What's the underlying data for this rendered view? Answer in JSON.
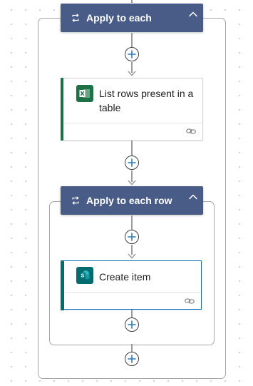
{
  "colors": {
    "scope_header": "#485c87",
    "excel": "#1e7145",
    "sharepoint": "#036c70",
    "plus": "#2a7ab8"
  },
  "outer_scope": {
    "title": "Apply to each",
    "icon": "loop-icon",
    "collapse_icon": "chevron-up-icon"
  },
  "list_rows_action": {
    "title": "List rows present in a table",
    "title_line1": "List rows present in a",
    "title_line2": "table",
    "icon": "excel-icon",
    "footer_icon": "link-icon"
  },
  "inner_scope": {
    "title": "Apply to each row",
    "icon": "loop-icon",
    "collapse_icon": "chevron-up-icon"
  },
  "create_item_action": {
    "title": "Create item",
    "icon": "sharepoint-icon",
    "footer_icon": "link-icon"
  },
  "insert_step": {
    "icon": "plus-icon"
  }
}
